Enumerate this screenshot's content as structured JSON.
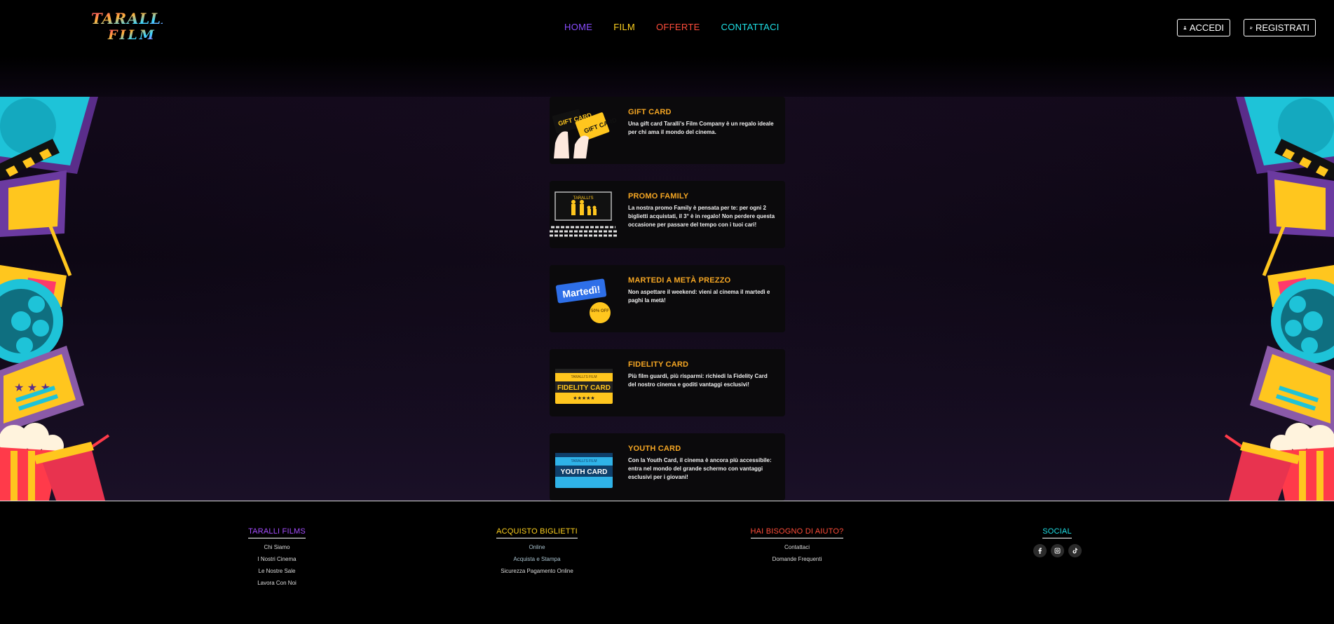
{
  "brand": {
    "logo_line1": "TARALLI's",
    "logo_line2": "FILM"
  },
  "nav": {
    "items": [
      {
        "label": "HOME",
        "color": "#8a4dff"
      },
      {
        "label": "FILM",
        "color": "#ffd21f"
      },
      {
        "label": "OFFERTE",
        "color": "#ff4d3a"
      },
      {
        "label": "CONTATTACI",
        "color": "#1fe0e6"
      }
    ],
    "login_label": "ACCEDI",
    "register_label": "REGISTRATI"
  },
  "offers": [
    {
      "title": "GIFT CARD",
      "text": "Una gift card Taralli's Film Company è un regalo ideale per chi ama il mondo del cinema.",
      "image": "gift-card"
    },
    {
      "title": "PROMO FAMILY",
      "text": "La nostra promo Family è pensata per te: per ogni 2 biglietti acquistati, il 3° è in regalo! Non perdere questa occasione per passare del tempo con i tuoi cari!",
      "image": "family"
    },
    {
      "title": "MARTEDI A METÀ PREZZO",
      "text": "Non aspettare il weekend: vieni al cinema il martedì e paghi la metà!",
      "image": "tuesday",
      "badge": "Martedì!",
      "sticker": "50% OFF"
    },
    {
      "title": "FIDELITY CARD",
      "text": "Più film guardi, più risparmi: richiedi la Fidelity Card del nostro cinema e goditi vantaggi esclusivi!",
      "image": "fidelity",
      "card_label": "FIDELITY CARD",
      "card_brand": "TARALLI'S FILM"
    },
    {
      "title": "YOUTH CARD",
      "text": "Con la Youth Card, il cinema è ancora più accessibile: entra nel mondo del grande schermo con vantaggi esclusivi per i giovani!",
      "image": "youth",
      "card_label": "YOUTH CARD",
      "card_brand": "TARALLI'S FILM"
    }
  ],
  "gift_card_label": "GIFT CARD",
  "family_screen_label": "TARALLI'S",
  "footer": {
    "columns": [
      {
        "title": "TARALLI FILMS",
        "color": "#a64dff",
        "links": [
          "Chi Siamo",
          "I Nostri Cinema",
          "Le Nostre Sale",
          "Lavora Con Noi"
        ]
      },
      {
        "title": "ACQUISTO BIGLIETTI",
        "color": "#ffd21f",
        "links": [
          "Online",
          "Acquista e Stampa",
          "Sicurezza Pagamento Online"
        ]
      },
      {
        "title": "HAI BISOGNO DI AIUTO?",
        "color": "#ff4d3a",
        "links": [
          "Contattaci",
          "Domande Frequenti"
        ]
      },
      {
        "title": "SOCIAL",
        "color": "#1fe0e6",
        "icons": [
          "facebook-icon",
          "instagram-icon",
          "tiktok-icon"
        ]
      }
    ]
  }
}
